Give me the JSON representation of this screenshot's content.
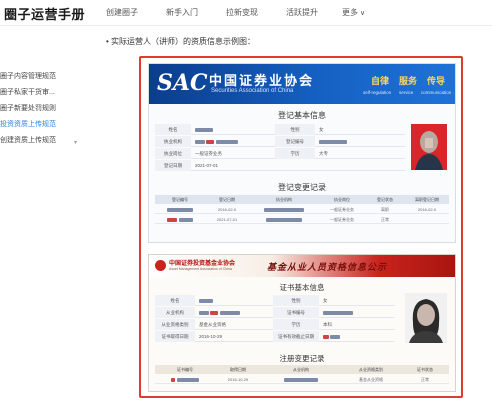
{
  "header": {
    "brand": "圈子运营手册",
    "nav": [
      "创建圈子",
      "新手入门",
      "拉新变现",
      "活跃提升",
      "更多"
    ]
  },
  "sidebar": {
    "items": [
      "圈子内容管理规范",
      "圈子私家干货审...",
      "圈子新要处罚规则",
      "投资资质上传规范",
      "创建资质上传规范"
    ],
    "active_index": 3
  },
  "content": {
    "bullet": "实际运营人（讲师）的资质信息示例图："
  },
  "sac_card": {
    "logo": "SAC",
    "name_cn": "中国证券业协会",
    "name_en": "Securities Association of China",
    "slogan": [
      "自律",
      "服务",
      "传导"
    ],
    "slogan_sub": [
      "self-regulation",
      "service",
      "communication"
    ],
    "section1": "登记基本信息",
    "fields": [
      {
        "label": "姓名",
        "label2": "性别",
        "value2": "女"
      },
      {
        "label": "执业机构",
        "label2": "登记编号"
      },
      {
        "label": "执业岗位",
        "value": "一般证券业务",
        "label2": "学历",
        "value2": "大专"
      },
      {
        "label": "登记日期",
        "value": "2021-07-01"
      }
    ],
    "section2": "登记变更记录",
    "table_headers": [
      "登记编号",
      "登记日期",
      "执业机构",
      "执业岗位",
      "登记状态",
      "离职登记日期"
    ],
    "table_rows": [
      {
        "date": "2016-02-0",
        "post": "一般证券业务",
        "status": "离职",
        "leave": "2016-02-0"
      },
      {
        "date": "2021-07-01",
        "post": "一般证券业务",
        "status": "正常"
      }
    ]
  },
  "amac_card": {
    "org_cn": "中国证券投资基金业协会",
    "org_en": "Asset Management Association of China",
    "title": "基金从业人员资格信息公示",
    "section1": "证书基本信息",
    "fields": [
      {
        "label": "姓名",
        "label2": "性别",
        "value2": "女"
      },
      {
        "label": "从业机构",
        "label2": "证书编号"
      },
      {
        "label": "从业资格类别",
        "value": "基金从业资格",
        "label2": "学历",
        "value2": "本科"
      },
      {
        "label": "证书取得日期",
        "value": "2016-10-29",
        "label2": "证书有效截止日期"
      }
    ],
    "section2": "注册变更记录",
    "table_headers": [
      "证书编号",
      "取得日期",
      "从业机构",
      "从业资格类别",
      "证书状态"
    ],
    "table_rows": [
      {
        "date": "2016-10-29",
        "type": "基金从业资格",
        "status": "正常"
      }
    ]
  }
}
